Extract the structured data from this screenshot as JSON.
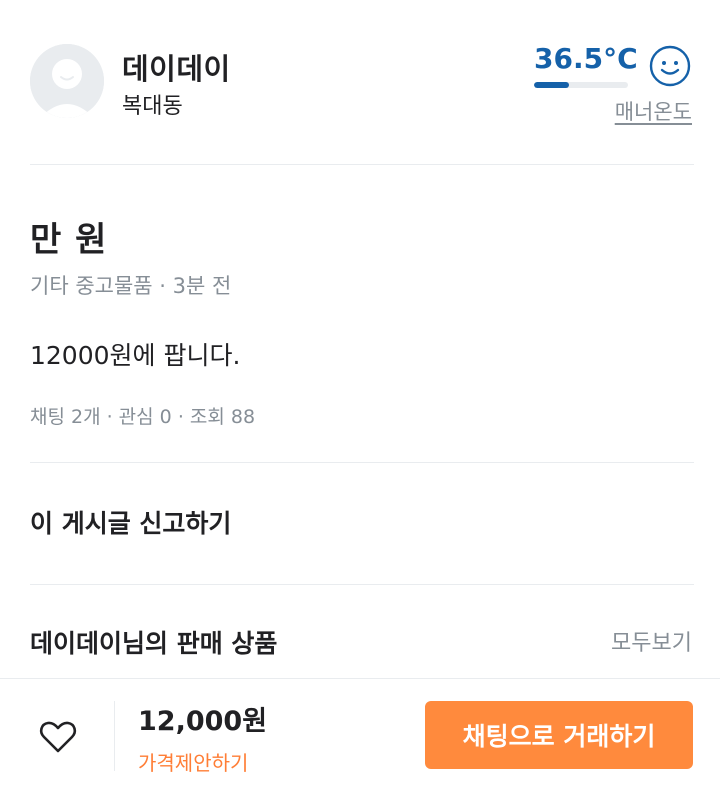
{
  "profile": {
    "nickname": "데이데이",
    "region": "복대동",
    "manner_temp": "36.5°C",
    "manner_fill": 0.37,
    "manner_label": "매너온도"
  },
  "article": {
    "title": "만 원",
    "meta": "기타 중고물품 · 3분 전",
    "description": "12000원에 팝니다.",
    "counts": "채팅 2개 · 관심 0 · 조회 88"
  },
  "report": {
    "label": "이 게시글 신고하기"
  },
  "seller_items": {
    "title": "데이데이님의 판매 상품",
    "view_all": "모두보기"
  },
  "bottom": {
    "price": "12,000원",
    "offer_label": "가격제안하기",
    "chat_button": "채팅으로 거래하기"
  },
  "colors": {
    "temp_blue": "#1561a9",
    "accent_orange": "#ff8a3d",
    "offer_orange": "#ff7e36"
  },
  "icons": {
    "avatar": "default-avatar-icon",
    "manner": "smile-face-icon",
    "like": "heart-icon"
  }
}
